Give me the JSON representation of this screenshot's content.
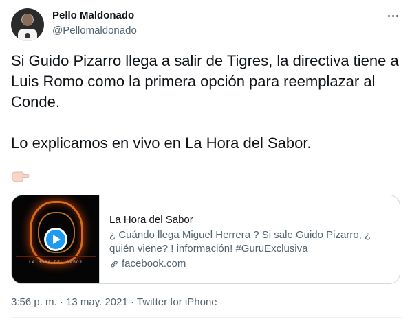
{
  "author": {
    "name": "Pello Maldonado",
    "handle": "@Pellomaldonado"
  },
  "tweet": {
    "paragraph_1": "Si Guido Pizarro llega a salir de Tigres, la directiva tiene a Luis Romo como la primera opción para reemplazar al Conde.",
    "paragraph_2": "Lo explicamos en vivo en La Hora del Sabor.",
    "emoji": "hand-pointing-right-icon"
  },
  "card": {
    "title": "La Hora del Sabor",
    "description": "¿ Cuándo llega Miguel Herrera ? Si sale Guido Pizarro, ¿ quién viene? ! información! #GuruExclusiva",
    "domain": "facebook.com",
    "thumbnail_caption": "LA HORA DEL SABOR",
    "play_icon": "play-icon"
  },
  "meta": {
    "time": "3:56 p. m.",
    "separator": "·",
    "date": "13 may. 2021",
    "source": "Twitter for iPhone"
  },
  "colors": {
    "accent": "#1d9bf0",
    "text_primary": "#0f1419",
    "text_secondary": "#536471",
    "border": "#cfd9de"
  }
}
